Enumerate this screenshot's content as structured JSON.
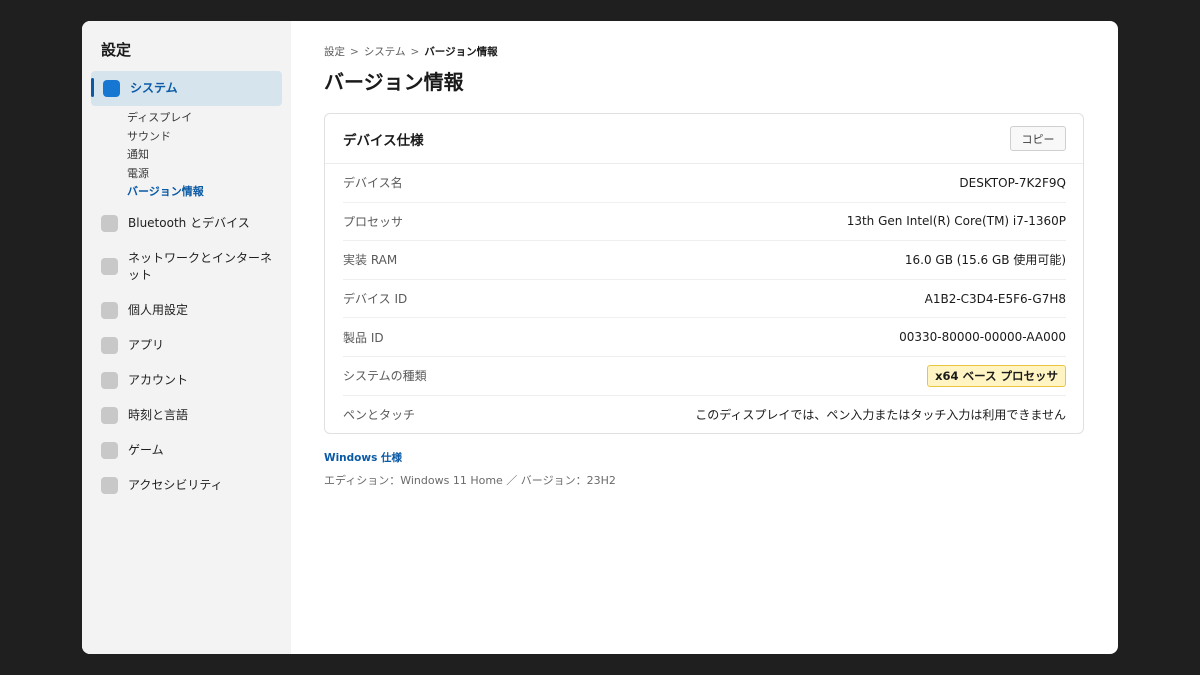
{
  "app": {
    "title": "設定"
  },
  "sidebar": {
    "active": {
      "label": "システム"
    },
    "subitems": [
      {
        "label": "ディスプレイ"
      },
      {
        "label": "サウンド"
      },
      {
        "label": "通知"
      },
      {
        "label": "電源"
      },
      {
        "label": "バージョン情報"
      }
    ],
    "items": [
      {
        "label": "Bluetooth とデバイス"
      },
      {
        "label": "ネットワークとインターネット"
      },
      {
        "label": "個人用設定"
      },
      {
        "label": "アプリ"
      },
      {
        "label": "アカウント"
      },
      {
        "label": "時刻と言語"
      },
      {
        "label": "ゲーム"
      },
      {
        "label": "アクセシビリティ"
      }
    ]
  },
  "breadcrumb": {
    "items": [
      "設定",
      "システム",
      "バージョン情報"
    ],
    "separator": ">"
  },
  "page": {
    "title": "バージョン情報"
  },
  "device_specs": {
    "title": "デバイス仕様",
    "copy_label": "コピー",
    "rows": [
      {
        "label": "デバイス名",
        "value": "DESKTOP-7K2F9Q"
      },
      {
        "label": "プロセッサ",
        "value": "13th Gen Intel(R) Core(TM) i7-1360P"
      },
      {
        "label": "実装 RAM",
        "value": "16.0 GB (15.6 GB 使用可能)"
      },
      {
        "label": "デバイス ID",
        "value": "A1B2-C3D4-E5F6-G7H8"
      },
      {
        "label": "製品 ID",
        "value": "00330-80000-00000-AA000"
      },
      {
        "label": "システムの種類",
        "value": "x64 ベース プロセッサ"
      },
      {
        "label": "ペンとタッチ",
        "value": "このディスプレイでは、ペン入力またはタッチ入力は利用できません"
      }
    ]
  },
  "windows_specs": {
    "link_label": "Windows 仕様",
    "edition_text": "エディション：Windows 11 Home ／ バージョン：23H2"
  },
  "colors": {
    "accent": "#0a5aa5",
    "badge_bg": "#fff4c2",
    "badge_border": "#e9c640"
  }
}
